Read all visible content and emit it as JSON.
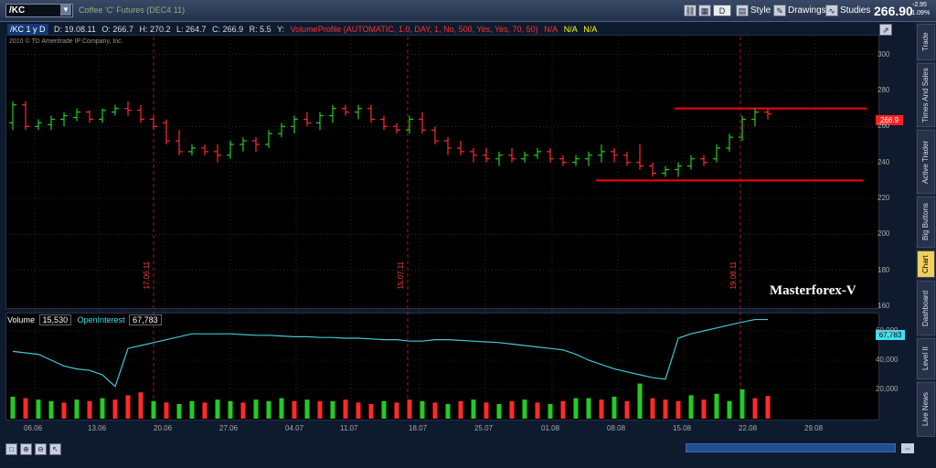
{
  "toolbar": {
    "symbol": "/KC",
    "description": "Coffee 'C' Futures (DEC4 11)",
    "d_label": "D",
    "style_label": "Style",
    "drawings_label": "Drawings",
    "studies_label": "Studies",
    "last_price": "266.90",
    "change": "-2.95",
    "change_pct": "-1.09%"
  },
  "info": {
    "symbol": "/KC 1 y D",
    "date": "D: 19.08.11",
    "open": "O: 266.7",
    "high": "H: 270.2",
    "low": "L: 264.7",
    "close": "C: 266.9",
    "range": "R: 5.5",
    "y": "Y:",
    "study": "VolumeProfile (AUTOMATIC, 1.0, DAY, 1, No, 500, Yes, Yes, 70, 50)",
    "na1": "N/A",
    "na2": "N/A",
    "na3": "N/A"
  },
  "copyright": "2010 © TD Ameritrade IP Company, Inc.",
  "watermark": "Masterforex-V",
  "price_tag": "266.9",
  "oi_tag": "67,783",
  "volume_bar": {
    "volume_label": "Volume",
    "volume_value": "15,530",
    "oi_label": "OpenInterest",
    "oi_value": "67,783"
  },
  "side_tabs": [
    "Trade",
    "Times And Sales",
    "Active Trader",
    "Big Buttons",
    "Chart",
    "Dashboard",
    "Level II",
    "Live News"
  ],
  "active_tab": "Chart",
  "colors": {
    "up": "#22cc22",
    "down": "#ff2a2a",
    "oi_line": "#40c8d8",
    "level": "#ff0000",
    "grid": "#444"
  },
  "chart_data": [
    {
      "type": "ohlc",
      "title": "/KC 1 y D",
      "ylim": [
        160,
        310
      ],
      "y_ticks": [
        160,
        180,
        200,
        220,
        240,
        260,
        280,
        300
      ],
      "x_ticks": [
        "06.06",
        "13.06",
        "20.06",
        "27.06",
        "04.07",
        "11.07",
        "18.07",
        "25.07",
        "01.08",
        "08.08",
        "15.08",
        "22.08",
        "29.08"
      ],
      "vertical_markers": [
        "17.06.11",
        "15.07.11",
        "19.08.11"
      ],
      "horizontal_levels": [
        270,
        230
      ],
      "candles": [
        {
          "o": 262,
          "h": 274,
          "l": 258,
          "c": 272
        },
        {
          "o": 272,
          "h": 274,
          "l": 258,
          "c": 260
        },
        {
          "o": 260,
          "h": 264,
          "l": 258,
          "c": 262
        },
        {
          "o": 261,
          "h": 266,
          "l": 258,
          "c": 264
        },
        {
          "o": 264,
          "h": 268,
          "l": 260,
          "c": 266
        },
        {
          "o": 265,
          "h": 270,
          "l": 263,
          "c": 268
        },
        {
          "o": 268,
          "h": 269,
          "l": 262,
          "c": 264
        },
        {
          "o": 264,
          "h": 270,
          "l": 262,
          "c": 269
        },
        {
          "o": 268,
          "h": 272,
          "l": 266,
          "c": 270
        },
        {
          "o": 270,
          "h": 274,
          "l": 266,
          "c": 269
        },
        {
          "o": 269,
          "h": 272,
          "l": 262,
          "c": 264
        },
        {
          "o": 264,
          "h": 266,
          "l": 258,
          "c": 260
        },
        {
          "o": 262,
          "h": 264,
          "l": 250,
          "c": 252
        },
        {
          "o": 252,
          "h": 258,
          "l": 244,
          "c": 246
        },
        {
          "o": 246,
          "h": 250,
          "l": 244,
          "c": 248
        },
        {
          "o": 248,
          "h": 250,
          "l": 244,
          "c": 246
        },
        {
          "o": 246,
          "h": 250,
          "l": 240,
          "c": 244
        },
        {
          "o": 244,
          "h": 252,
          "l": 242,
          "c": 250
        },
        {
          "o": 250,
          "h": 254,
          "l": 246,
          "c": 252
        },
        {
          "o": 252,
          "h": 254,
          "l": 246,
          "c": 250
        },
        {
          "o": 250,
          "h": 258,
          "l": 248,
          "c": 256
        },
        {
          "o": 256,
          "h": 262,
          "l": 254,
          "c": 260
        },
        {
          "o": 260,
          "h": 266,
          "l": 256,
          "c": 264
        },
        {
          "o": 264,
          "h": 268,
          "l": 260,
          "c": 262
        },
        {
          "o": 262,
          "h": 268,
          "l": 258,
          "c": 266
        },
        {
          "o": 266,
          "h": 272,
          "l": 262,
          "c": 270
        },
        {
          "o": 270,
          "h": 272,
          "l": 266,
          "c": 268
        },
        {
          "o": 268,
          "h": 272,
          "l": 264,
          "c": 270
        },
        {
          "o": 270,
          "h": 272,
          "l": 262,
          "c": 264
        },
        {
          "o": 264,
          "h": 266,
          "l": 258,
          "c": 260
        },
        {
          "o": 260,
          "h": 262,
          "l": 256,
          "c": 258
        },
        {
          "o": 258,
          "h": 266,
          "l": 256,
          "c": 264
        },
        {
          "o": 264,
          "h": 268,
          "l": 256,
          "c": 258
        },
        {
          "o": 258,
          "h": 260,
          "l": 250,
          "c": 252
        },
        {
          "o": 252,
          "h": 254,
          "l": 244,
          "c": 248
        },
        {
          "o": 248,
          "h": 252,
          "l": 244,
          "c": 246
        },
        {
          "o": 246,
          "h": 248,
          "l": 240,
          "c": 244
        },
        {
          "o": 244,
          "h": 248,
          "l": 240,
          "c": 242
        },
        {
          "o": 242,
          "h": 246,
          "l": 238,
          "c": 244
        },
        {
          "o": 244,
          "h": 248,
          "l": 240,
          "c": 242
        },
        {
          "o": 242,
          "h": 246,
          "l": 240,
          "c": 244
        },
        {
          "o": 244,
          "h": 248,
          "l": 242,
          "c": 246
        },
        {
          "o": 246,
          "h": 248,
          "l": 240,
          "c": 242
        },
        {
          "o": 242,
          "h": 244,
          "l": 238,
          "c": 240
        },
        {
          "o": 240,
          "h": 244,
          "l": 238,
          "c": 242
        },
        {
          "o": 242,
          "h": 246,
          "l": 238,
          "c": 244
        },
        {
          "o": 244,
          "h": 250,
          "l": 240,
          "c": 246
        },
        {
          "o": 246,
          "h": 248,
          "l": 240,
          "c": 244
        },
        {
          "o": 244,
          "h": 246,
          "l": 238,
          "c": 240
        },
        {
          "o": 240,
          "h": 250,
          "l": 236,
          "c": 238
        },
        {
          "o": 238,
          "h": 240,
          "l": 232,
          "c": 234
        },
        {
          "o": 234,
          "h": 238,
          "l": 232,
          "c": 236
        },
        {
          "o": 236,
          "h": 240,
          "l": 232,
          "c": 238
        },
        {
          "o": 238,
          "h": 244,
          "l": 236,
          "c": 242
        },
        {
          "o": 242,
          "h": 244,
          "l": 238,
          "c": 240
        },
        {
          "o": 242,
          "h": 250,
          "l": 240,
          "c": 248
        },
        {
          "o": 248,
          "h": 256,
          "l": 246,
          "c": 254
        },
        {
          "o": 254,
          "h": 266,
          "l": 252,
          "c": 264
        },
        {
          "o": 264,
          "h": 270,
          "l": 260,
          "c": 268
        },
        {
          "o": 268,
          "h": 270,
          "l": 264,
          "c": 267
        }
      ]
    },
    {
      "type": "bar+line",
      "title": "Volume / OpenInterest",
      "ylim": [
        0,
        70000
      ],
      "y_ticks": [
        "20,000",
        "40,000",
        "60,000"
      ],
      "volume": [
        {
          "v": 15000,
          "up": true
        },
        {
          "v": 14000,
          "up": false
        },
        {
          "v": 13000,
          "up": true
        },
        {
          "v": 12000,
          "up": true
        },
        {
          "v": 11000,
          "up": false
        },
        {
          "v": 13000,
          "up": true
        },
        {
          "v": 12000,
          "up": false
        },
        {
          "v": 14000,
          "up": true
        },
        {
          "v": 13000,
          "up": false
        },
        {
          "v": 16000,
          "up": false
        },
        {
          "v": 18000,
          "up": false
        },
        {
          "v": 12000,
          "up": true
        },
        {
          "v": 11000,
          "up": false
        },
        {
          "v": 10000,
          "up": true
        },
        {
          "v": 12000,
          "up": true
        },
        {
          "v": 11000,
          "up": false
        },
        {
          "v": 13000,
          "up": true
        },
        {
          "v": 12000,
          "up": true
        },
        {
          "v": 11000,
          "up": false
        },
        {
          "v": 13000,
          "up": true
        },
        {
          "v": 12000,
          "up": true
        },
        {
          "v": 14000,
          "up": true
        },
        {
          "v": 12000,
          "up": false
        },
        {
          "v": 13000,
          "up": true
        },
        {
          "v": 12000,
          "up": false
        },
        {
          "v": 12000,
          "up": true
        },
        {
          "v": 13000,
          "up": false
        },
        {
          "v": 11000,
          "up": false
        },
        {
          "v": 10000,
          "up": false
        },
        {
          "v": 12000,
          "up": true
        },
        {
          "v": 11000,
          "up": false
        },
        {
          "v": 13000,
          "up": false
        },
        {
          "v": 12000,
          "up": true
        },
        {
          "v": 11000,
          "up": false
        },
        {
          "v": 10000,
          "up": true
        },
        {
          "v": 12000,
          "up": false
        },
        {
          "v": 13000,
          "up": true
        },
        {
          "v": 11000,
          "up": false
        },
        {
          "v": 10000,
          "up": true
        },
        {
          "v": 12000,
          "up": false
        },
        {
          "v": 13000,
          "up": true
        },
        {
          "v": 11000,
          "up": false
        },
        {
          "v": 10000,
          "up": true
        },
        {
          "v": 12000,
          "up": false
        },
        {
          "v": 14000,
          "up": true
        },
        {
          "v": 14000,
          "up": true
        },
        {
          "v": 13000,
          "up": false
        },
        {
          "v": 15000,
          "up": true
        },
        {
          "v": 12000,
          "up": false
        },
        {
          "v": 24000,
          "up": true
        },
        {
          "v": 14000,
          "up": false
        },
        {
          "v": 13000,
          "up": false
        },
        {
          "v": 12000,
          "up": false
        },
        {
          "v": 16000,
          "up": true
        },
        {
          "v": 13000,
          "up": false
        },
        {
          "v": 17000,
          "up": true
        },
        {
          "v": 12000,
          "up": true
        },
        {
          "v": 20000,
          "up": true
        },
        {
          "v": 14000,
          "up": false
        },
        {
          "v": 15530,
          "up": false
        }
      ],
      "open_interest": [
        46000,
        45000,
        44000,
        40000,
        36000,
        34000,
        33000,
        30000,
        22000,
        48000,
        50000,
        52000,
        54000,
        56000,
        58000,
        58000,
        58000,
        58000,
        57500,
        57000,
        57000,
        56500,
        56000,
        56000,
        55500,
        55500,
        55000,
        55000,
        54500,
        54000,
        54000,
        53000,
        53000,
        54000,
        54000,
        53500,
        53000,
        52500,
        52000,
        51000,
        50000,
        49000,
        48000,
        47000,
        44000,
        40000,
        37000,
        34000,
        32000,
        30000,
        28000,
        27000,
        55000,
        58000,
        60000,
        62000,
        64000,
        66000,
        67783,
        67783
      ]
    }
  ]
}
